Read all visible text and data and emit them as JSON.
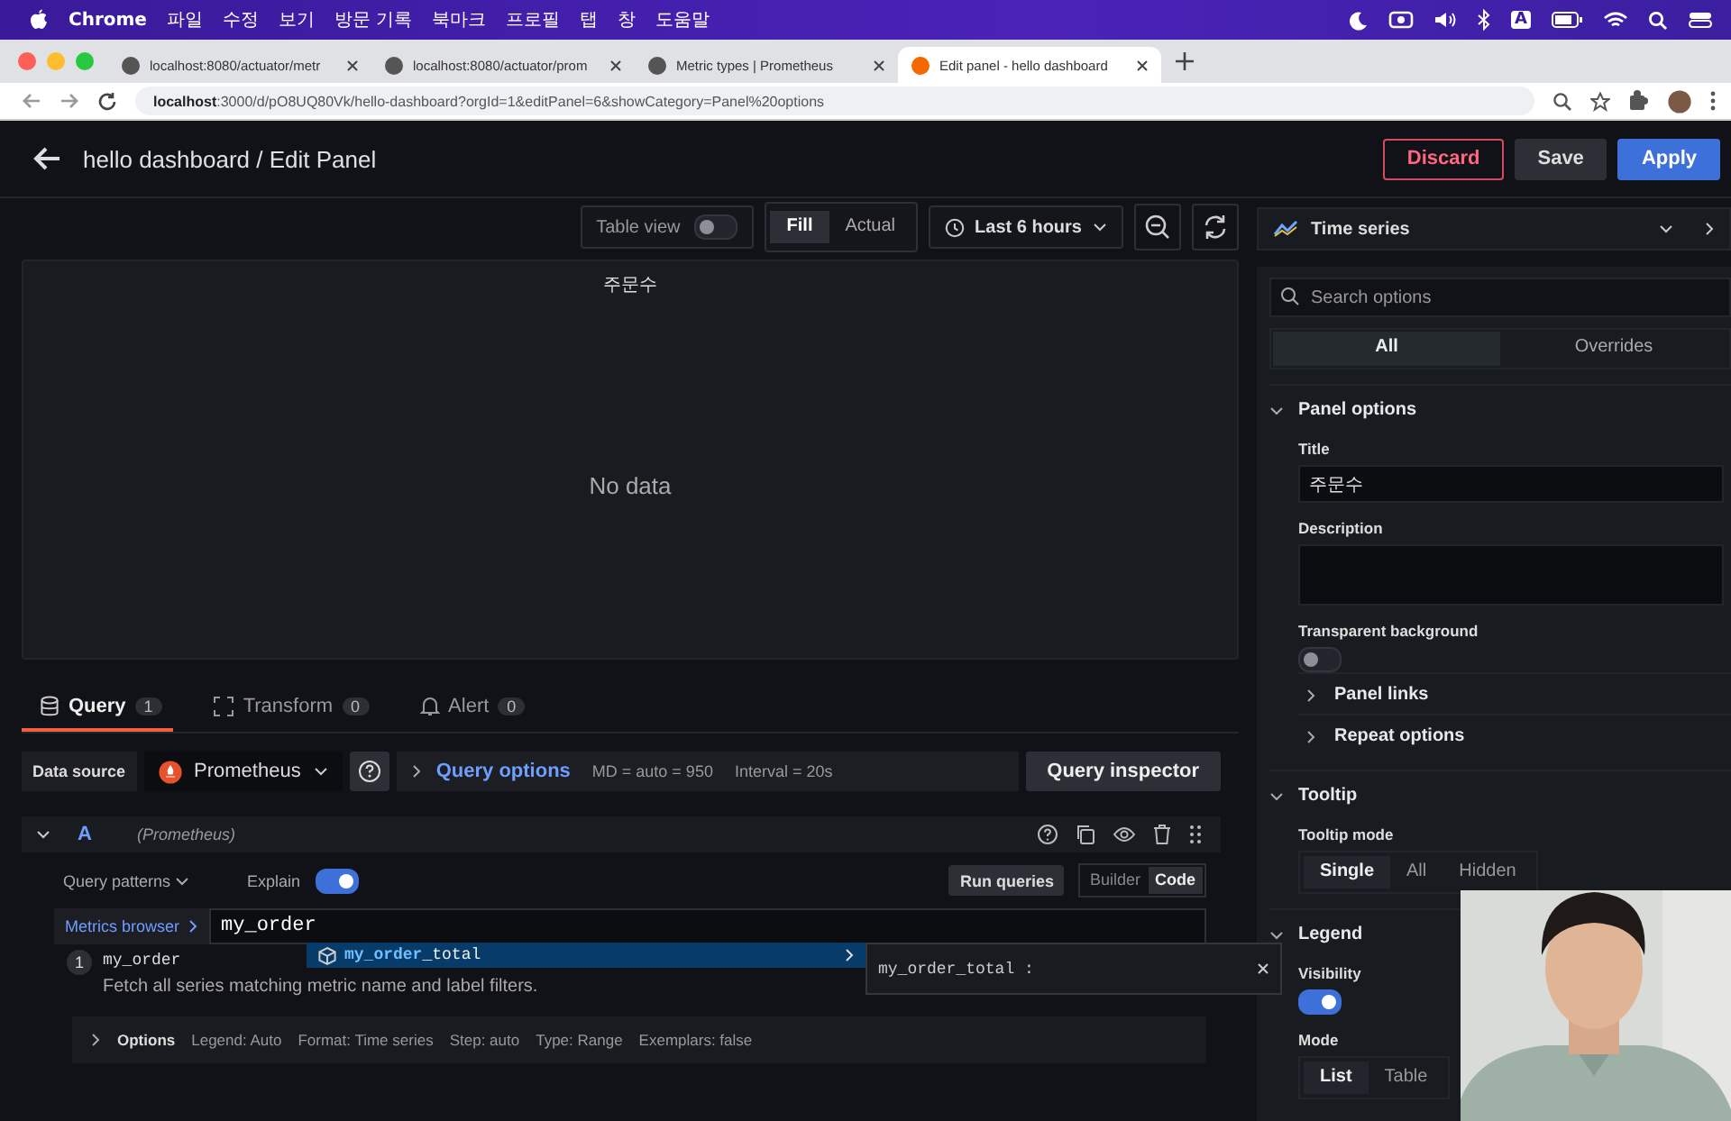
{
  "menubar": {
    "app": "Chrome",
    "menus": [
      "파일",
      "수정",
      "보기",
      "방문 기록",
      "북마크",
      "프로필",
      "탭",
      "창",
      "도움말"
    ],
    "input_source": "A"
  },
  "browser_tabs": [
    {
      "title": "localhost:8080/actuator/metr",
      "selected": false
    },
    {
      "title": "localhost:8080/actuator/prom",
      "selected": false
    },
    {
      "title": "Metric types | Prometheus",
      "selected": false
    },
    {
      "title": "Edit panel - hello dashboard",
      "selected": true
    }
  ],
  "address": {
    "host": "localhost",
    "rest": ":3000/d/pO8UQ80Vk/hello-dashboard?orgId=1&editPanel=6&showCategory=Panel%20options"
  },
  "header": {
    "title": "hello dashboard / Edit Panel",
    "buttons": [
      {
        "label": "Discard",
        "kind": "danger"
      },
      {
        "label": "Save",
        "kind": "secondary"
      },
      {
        "label": "Apply",
        "kind": "primary"
      }
    ]
  },
  "toolbar": {
    "table_view": {
      "label": "Table view",
      "on": false
    },
    "size_modes": [
      {
        "label": "Fill",
        "selected": true
      },
      {
        "label": "Actual",
        "selected": false
      }
    ],
    "time_range": "Last 6 hours",
    "visualization": "Time series"
  },
  "panel": {
    "title": "주문수",
    "message": "No data"
  },
  "query_tabs": [
    {
      "label": "Query",
      "count": "1",
      "selected": true
    },
    {
      "label": "Transform",
      "count": "0",
      "selected": false
    },
    {
      "label": "Alert",
      "count": "0",
      "selected": false
    }
  ],
  "data_source": {
    "label": "Data source",
    "name": "Prometheus",
    "query_options": "Query options",
    "md": "MD = auto = 950",
    "interval": "Interval = 20s",
    "inspector": "Query inspector"
  },
  "query": {
    "ref": "A",
    "source": "(Prometheus)",
    "patterns": "Query patterns",
    "explain": {
      "label": "Explain",
      "on": true
    },
    "run": "Run queries",
    "modes": [
      {
        "label": "Builder",
        "selected": false
      },
      {
        "label": "Code",
        "selected": true
      }
    ],
    "metrics_browser": "Metrics browser",
    "value": "my_order",
    "suggestion": {
      "match": "my_order",
      "rest": "_total",
      "detail": "my_order_total :"
    },
    "explain_step": {
      "number": "1",
      "code": "my_order",
      "text": "Fetch all series matching metric name and label filters."
    },
    "options": {
      "label": "Options",
      "items": [
        "Legend: Auto",
        "Format: Time series",
        "Step: auto",
        "Type: Range",
        "Exemplars: false"
      ]
    }
  },
  "options_pane": {
    "search_placeholder": "Search options",
    "tabs": [
      {
        "label": "All",
        "selected": true
      },
      {
        "label": "Overrides",
        "selected": false
      }
    ],
    "panel_options": {
      "heading": "Panel options",
      "title_label": "Title",
      "title_value": "주문수",
      "description_label": "Description",
      "transparent": {
        "label": "Transparent background",
        "on": false
      },
      "subsections": [
        "Panel links",
        "Repeat options"
      ]
    },
    "tooltip": {
      "heading": "Tooltip",
      "mode_label": "Tooltip mode",
      "modes": [
        {
          "label": "Single",
          "selected": true
        },
        {
          "label": "All",
          "selected": false
        },
        {
          "label": "Hidden",
          "selected": false
        }
      ]
    },
    "legend": {
      "heading": "Legend",
      "visibility": {
        "label": "Visibility",
        "on": true
      },
      "mode_label": "Mode",
      "modes": [
        {
          "label": "List",
          "selected": true
        },
        {
          "label": "Table",
          "selected": false
        }
      ]
    }
  }
}
